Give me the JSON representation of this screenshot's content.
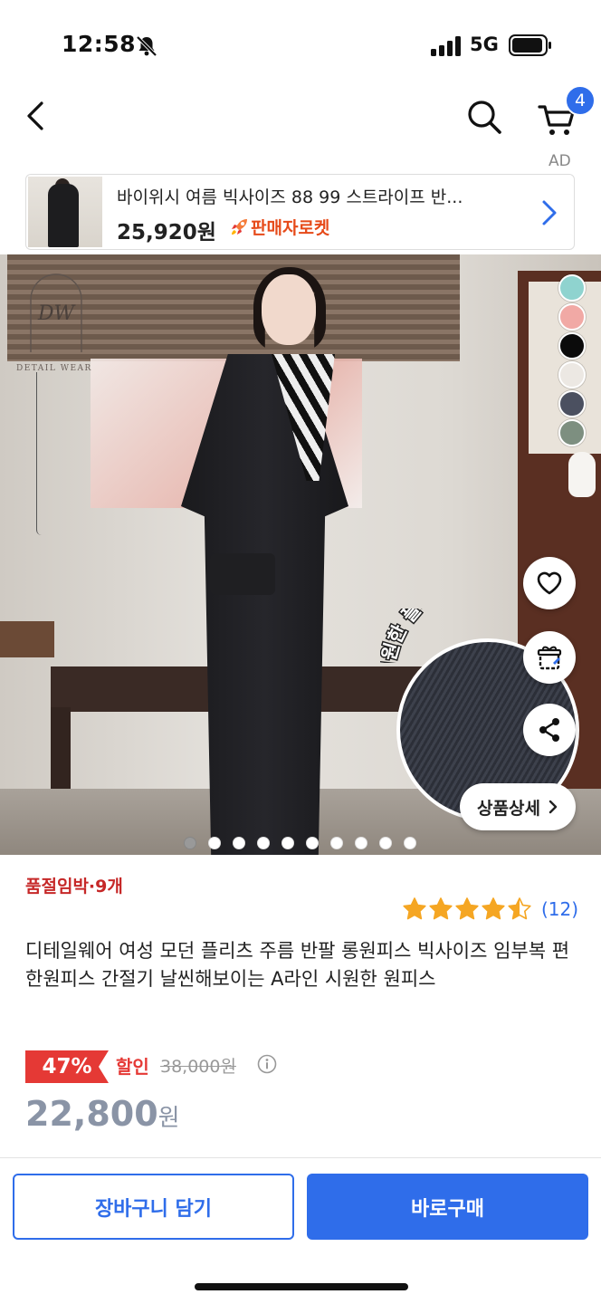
{
  "status_bar": {
    "time": "12:58",
    "network": "5G"
  },
  "header": {
    "cart_count": "4",
    "ad_label": "AD"
  },
  "ad_banner": {
    "title": "바이위시 여름 빅사이즈 88 99 스트라이프 반...",
    "price": "25,920원",
    "badge": "판매자로켓",
    "badge_color": "#e64a19"
  },
  "hero": {
    "logo_text": "DETAIL WEAR",
    "detail_caption": "시원한 플리츠 주름",
    "detail_button": "상품상세",
    "swatch_colors": [
      "#8fd3cf",
      "#f1a9a5",
      "#0b0b0b",
      "#ece8e3",
      "#4b5060",
      "#7d8f80"
    ],
    "page_count": 10,
    "active_page": 1
  },
  "product": {
    "stock_status": "품절임박·9개",
    "rating_value": 4.5,
    "review_count": "(12)",
    "title": "디테일웨어 여성 모던 플리츠 주름 반팔 롱원피스 빅사이즈 임부복 편한원피스 간절기 날씬해보이는 A라인 시원한 원피스",
    "discount_percent": "47%",
    "discount_label": "할인",
    "original_price": "38,000원",
    "sale_price": "22,800",
    "sale_currency": "원",
    "colors": {
      "accent": "#2f6dea",
      "sale_red": "#e53935",
      "stock_red": "#c62828",
      "star": "#f5a623"
    }
  },
  "bottom_bar": {
    "cart_button": "장바구니 담기",
    "buy_button": "바로구매"
  }
}
